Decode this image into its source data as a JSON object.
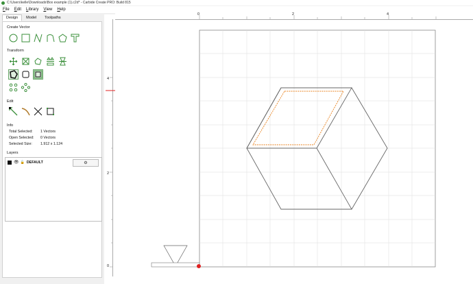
{
  "window": {
    "title": "C:\\Users\\kelle\\Downloads\\Box example (1).c2d* - Carbide Create PRO: Build 815"
  },
  "menu": [
    "File",
    "Edit",
    "Library",
    "View",
    "Help"
  ],
  "tabs": {
    "design": "Design",
    "model": "Model",
    "toolpaths": "Toolpaths"
  },
  "sections": {
    "create_vector": "Create Vector",
    "transform": "Transform",
    "edit": "Edit",
    "info": "Info",
    "layers": "Layers"
  },
  "info": {
    "total_selected_label": "Total Selected:",
    "total_selected_value": "1 Vectors",
    "open_selected_label": "Open Selected:",
    "open_selected_value": "0 Vectors",
    "selected_size_label": "Selected Size:",
    "selected_size_value": "1.912 x 1.124"
  },
  "layers": [
    {
      "name": "DEFAULT",
      "color": "#111111",
      "settings_icon": "gear-icon",
      "visibility_icon": "eye-icon",
      "lock_icon": "lock-icon"
    }
  ],
  "rulers": {
    "horizontal": [
      "0",
      "2",
      "4"
    ],
    "vertical": [
      "4",
      "2",
      "0"
    ]
  },
  "colors": {
    "accent": "#3a8f3a",
    "selection": "#e8821e",
    "origin": "#e02020"
  }
}
